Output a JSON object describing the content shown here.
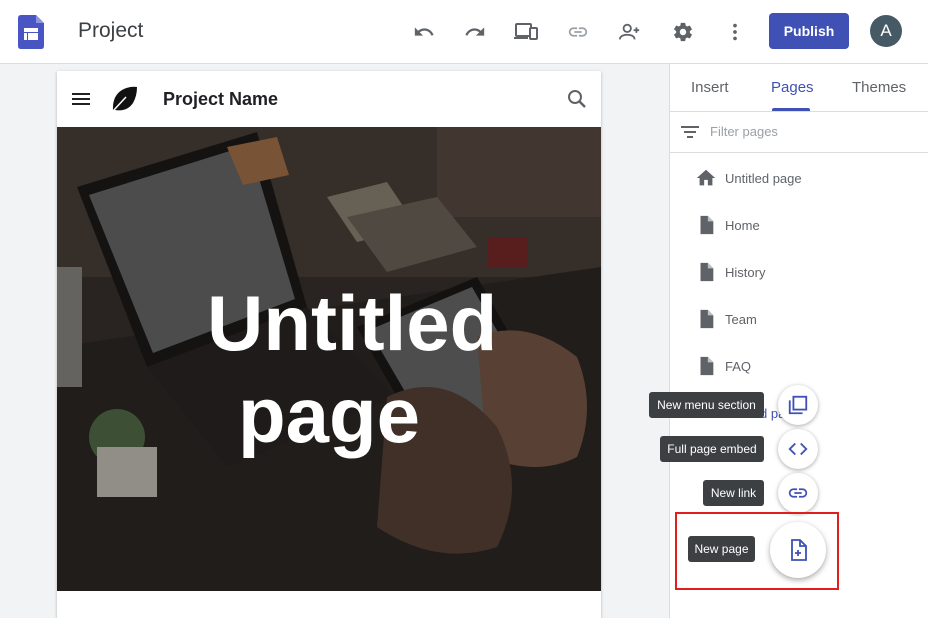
{
  "app": {
    "title": "Project",
    "logo_icon": "sites-logo-icon"
  },
  "toolbar": {
    "icons": [
      "undo-icon",
      "redo-icon",
      "preview-devices-icon",
      "link-icon",
      "share-person-add-icon",
      "settings-gear-icon",
      "more-vert-icon"
    ],
    "publish_label": "Publish",
    "avatar_letter": "A"
  },
  "site": {
    "name": "Project Name",
    "hero_title": "Untitled page"
  },
  "panel": {
    "tabs": [
      {
        "label": "Insert",
        "active": false
      },
      {
        "label": "Pages",
        "active": true
      },
      {
        "label": "Themes",
        "active": false
      }
    ],
    "filter_placeholder": "Filter pages",
    "pages": [
      {
        "label": "Untitled page",
        "icon": "home-icon"
      },
      {
        "label": "Home",
        "icon": "page-icon"
      },
      {
        "label": "History",
        "icon": "page-icon"
      },
      {
        "label": "Team",
        "icon": "page-icon"
      },
      {
        "label": "FAQ",
        "icon": "page-icon"
      }
    ],
    "partial_item_label": "d pa"
  },
  "speed_dial": {
    "new_menu_section": "New menu section",
    "full_page_embed": "Full page embed",
    "new_link": "New link",
    "new_page": "New page"
  },
  "colors": {
    "accent": "#3f51b5",
    "highlight": "#e01e1e"
  }
}
